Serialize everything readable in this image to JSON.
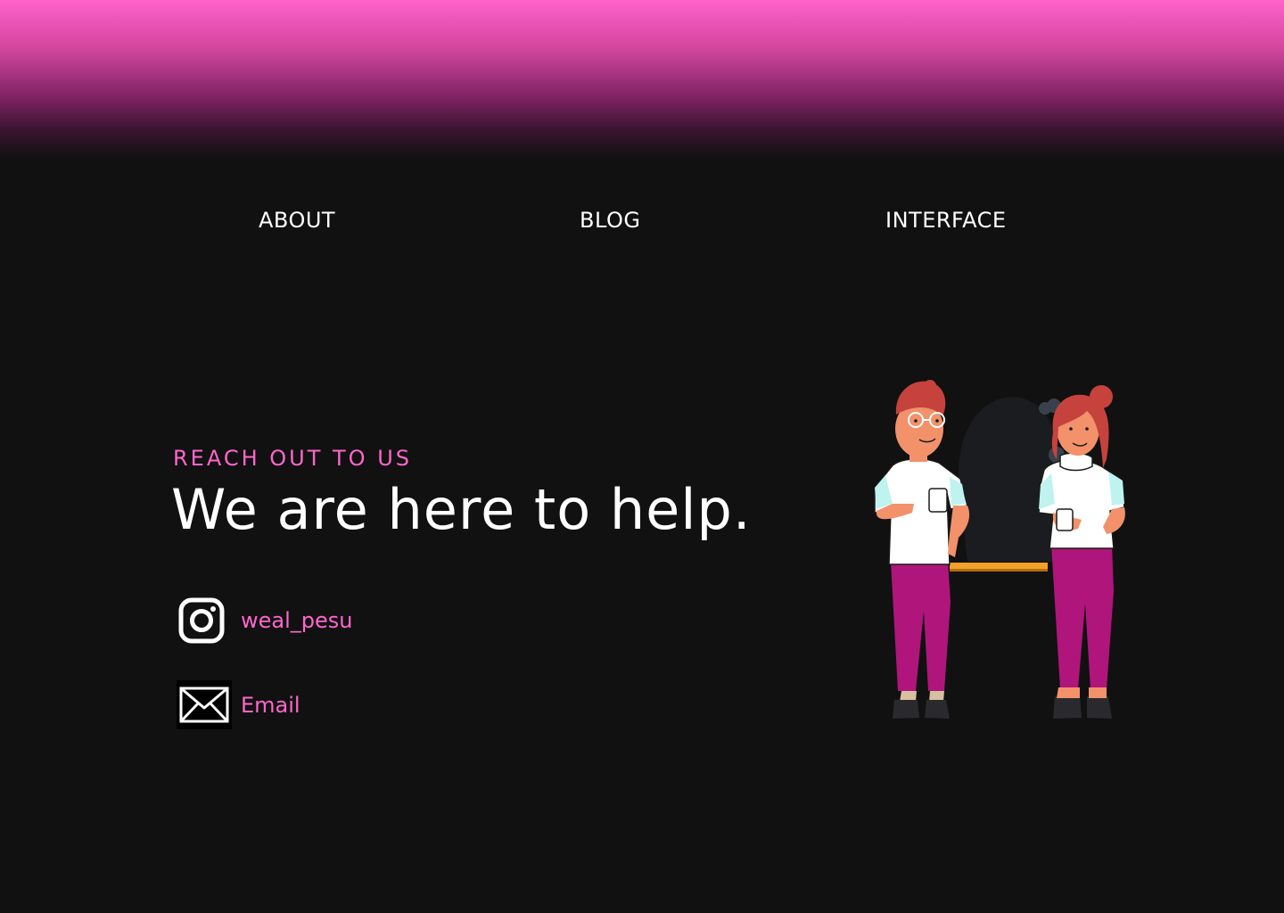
{
  "nav": {
    "items": [
      {
        "label": "ABOUT"
      },
      {
        "label": "BLOG"
      },
      {
        "label": "INTERFACE"
      }
    ]
  },
  "hero": {
    "eyebrow": "REACH OUT TO US",
    "headline": "We are here to help."
  },
  "contacts": [
    {
      "icon": "instagram-icon",
      "label": "weal_pesu"
    },
    {
      "icon": "mail-icon",
      "label": "Email"
    }
  ],
  "colors": {
    "background": "#111111",
    "accent": "#ff66cc",
    "gradient_top": "#ff62cb",
    "text": "#ffffff"
  }
}
